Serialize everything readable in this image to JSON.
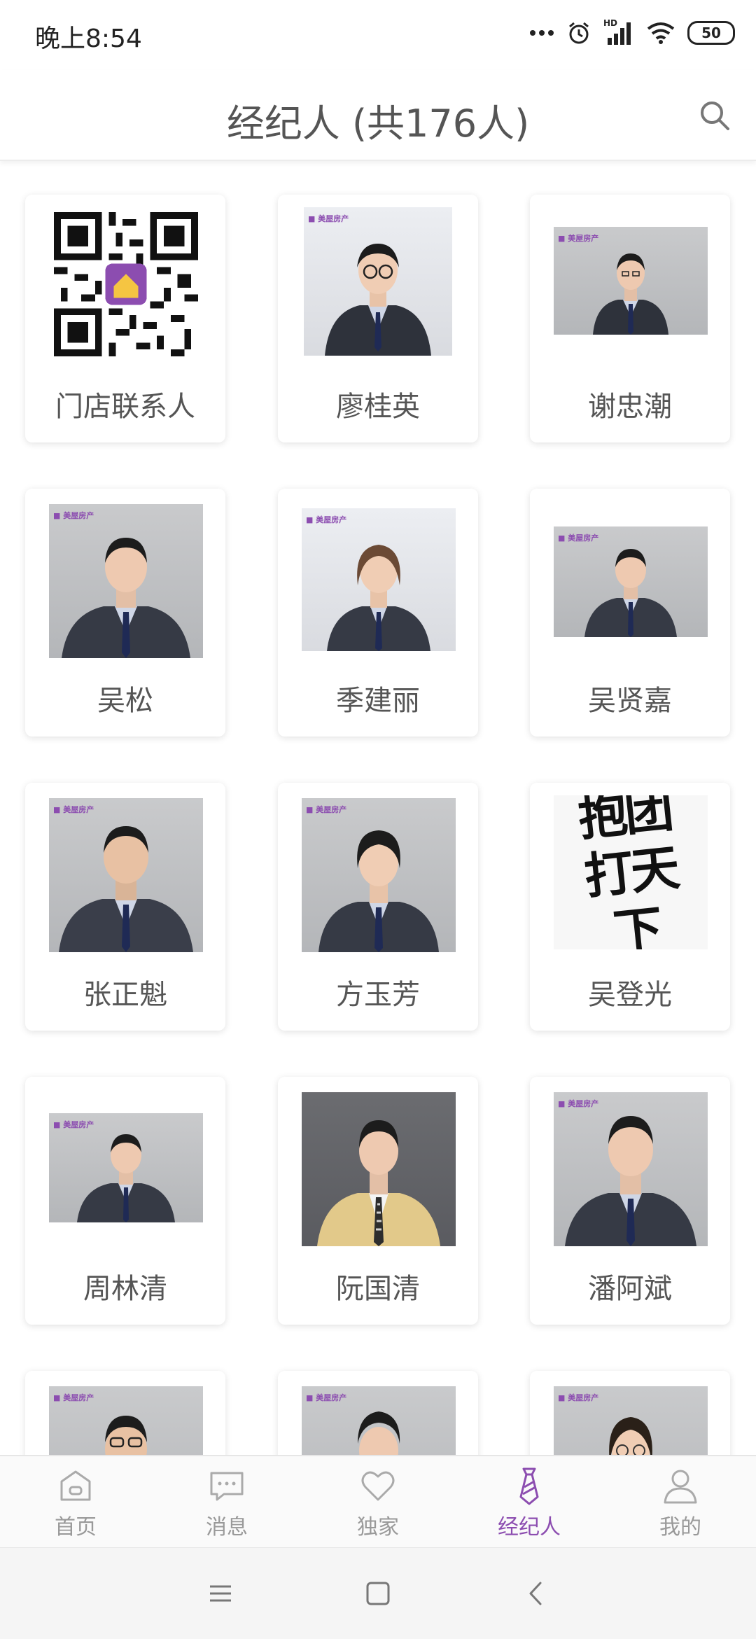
{
  "status_bar": {
    "time": "晚上8:54",
    "icons": [
      "more-dots-icon",
      "alarm-icon",
      "hd-signal-icon",
      "wifi-icon",
      "battery-icon"
    ],
    "signal_label": "HD",
    "battery": "50"
  },
  "header": {
    "title": "经纪人 (共176人)"
  },
  "grid": {
    "cards": [
      {
        "name": "门店联系人",
        "photo": "qr-code"
      },
      {
        "name": "廖桂英",
        "photo": "portrait"
      },
      {
        "name": "谢忠潮",
        "photo": "portrait"
      },
      {
        "name": "吴松",
        "photo": "portrait"
      },
      {
        "name": "季建丽",
        "photo": "portrait"
      },
      {
        "name": "吴贤嘉",
        "photo": "portrait"
      },
      {
        "name": "张正魁",
        "photo": "portrait"
      },
      {
        "name": "方玉芳",
        "photo": "portrait"
      },
      {
        "name": "吴登光",
        "photo": "calligraphy"
      },
      {
        "name": "周林清",
        "photo": "portrait"
      },
      {
        "name": "阮国清",
        "photo": "portrait"
      },
      {
        "name": "潘阿斌",
        "photo": "portrait"
      },
      {
        "name": "",
        "photo": "portrait"
      },
      {
        "name": "",
        "photo": "portrait"
      },
      {
        "name": "",
        "photo": "portrait"
      }
    ],
    "calligraphy_text": "抱团打天下"
  },
  "bottom_nav": {
    "items": [
      {
        "label": "首页",
        "icon": "home-icon"
      },
      {
        "label": "消息",
        "icon": "message-icon"
      },
      {
        "label": "独家",
        "icon": "heart-icon"
      },
      {
        "label": "经纪人",
        "icon": "necktie-icon",
        "active": true
      },
      {
        "label": "我的",
        "icon": "user-icon"
      }
    ]
  },
  "colors": {
    "accent": "#8c4db0",
    "text": "#555555",
    "inactive": "#999999"
  }
}
